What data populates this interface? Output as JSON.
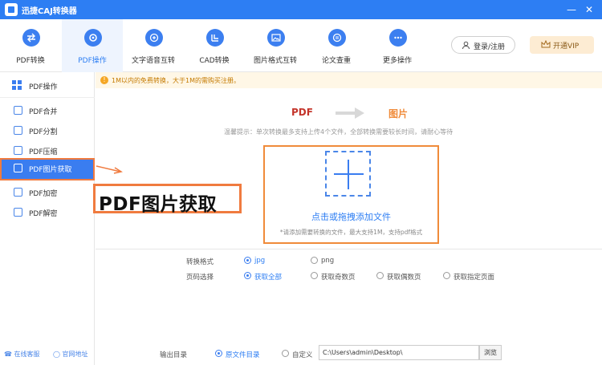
{
  "app": {
    "title": "迅捷CAJ转换器"
  },
  "nav": {
    "items": [
      {
        "label": "PDF转换",
        "icon": "convert-arrows-icon"
      },
      {
        "label": "PDF操作",
        "icon": "gear-icon"
      },
      {
        "label": "文字语音互转",
        "icon": "voice-icon"
      },
      {
        "label": "CAD转换",
        "icon": "cad-icon"
      },
      {
        "label": "图片格式互转",
        "icon": "image-icon"
      },
      {
        "label": "论文查重",
        "icon": "paper-check-icon"
      },
      {
        "label": "更多操作",
        "icon": "more-dots-icon"
      }
    ],
    "active": "PDF操作",
    "login_label": "登录/注册",
    "vip_label": "开通VIP"
  },
  "sidebar": {
    "header": "PDF操作",
    "items": [
      {
        "label": "PDF合并"
      },
      {
        "label": "PDF分割"
      },
      {
        "label": "PDF压缩"
      },
      {
        "label": "PDF图片获取"
      },
      {
        "label": "PDF加密"
      },
      {
        "label": "PDF解密"
      }
    ],
    "active": "PDF图片获取",
    "footer_service": "在线客服",
    "footer_site": "官网地址"
  },
  "main": {
    "notice": "1M以内的免费转换，大于1M的需购买注册。",
    "from_label": "PDF",
    "to_label": "图片",
    "hint": "温馨提示：单次转换最多支持上传4个文件，全部转换需要较长时间，请耐心等待",
    "drop_title": "点击或拖拽添加文件",
    "drop_subtitle": "*请添加需要转换的文件，最大支持1M，支持pdf格式",
    "format": {
      "label": "转换格式",
      "options": [
        "jpg",
        "png"
      ],
      "selected": "jpg"
    },
    "pages": {
      "label": "页码选择",
      "options": [
        "获取全部",
        "获取奇数页",
        "获取偶数页",
        "获取指定页面"
      ],
      "selected": "获取全部"
    },
    "output": {
      "label": "输出目录",
      "options": [
        "原文件目录",
        "自定义"
      ],
      "selected": "原文件目录",
      "path": "C:\\Users\\admin\\Desktop\\",
      "browse_label": "浏览"
    }
  },
  "annotation": {
    "text": "PDF图片获取"
  },
  "colors": {
    "primary": "#2d7ef3",
    "accent": "#f07b3f",
    "pdf_red": "#c4352b",
    "image_orange": "#f08b3a"
  }
}
